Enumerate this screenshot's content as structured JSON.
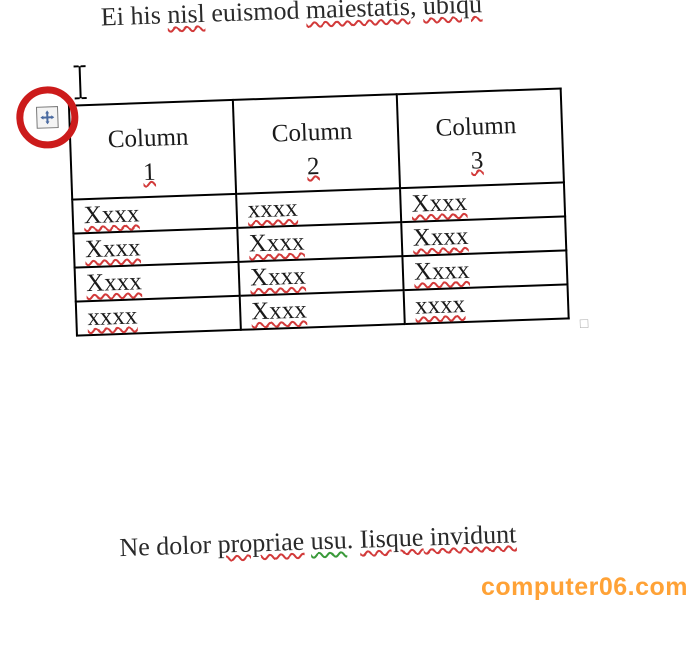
{
  "paragraph_top": {
    "t1": "Ei his ",
    "t2": "nisl",
    "t3": " euismod ",
    "t4": "maiestatis",
    "t5": ", ",
    "t6": "ubiqu"
  },
  "table": {
    "headers": [
      {
        "label": "Column",
        "num": "1"
      },
      {
        "label": "Column",
        "num": "2"
      },
      {
        "label": "Column",
        "num": "3"
      }
    ],
    "rows": [
      [
        "Xxxx",
        "xxxx",
        "Xxxx"
      ],
      [
        "Xxxx",
        "Xxxx",
        "Xxxx"
      ],
      [
        "Xxxx",
        "Xxxx",
        "Xxxx"
      ],
      [
        "xxxx",
        "Xxxx",
        "xxxx"
      ]
    ]
  },
  "paragraph_bottom": {
    "t1": "Ne dolor ",
    "t2": "propriae",
    "t3": " ",
    "t4": "usu",
    "t5": ". ",
    "t6": "Iisque",
    "t7": " invidunt"
  },
  "watermark": "computer06.com",
  "annotation_color": "#cc1b1b"
}
